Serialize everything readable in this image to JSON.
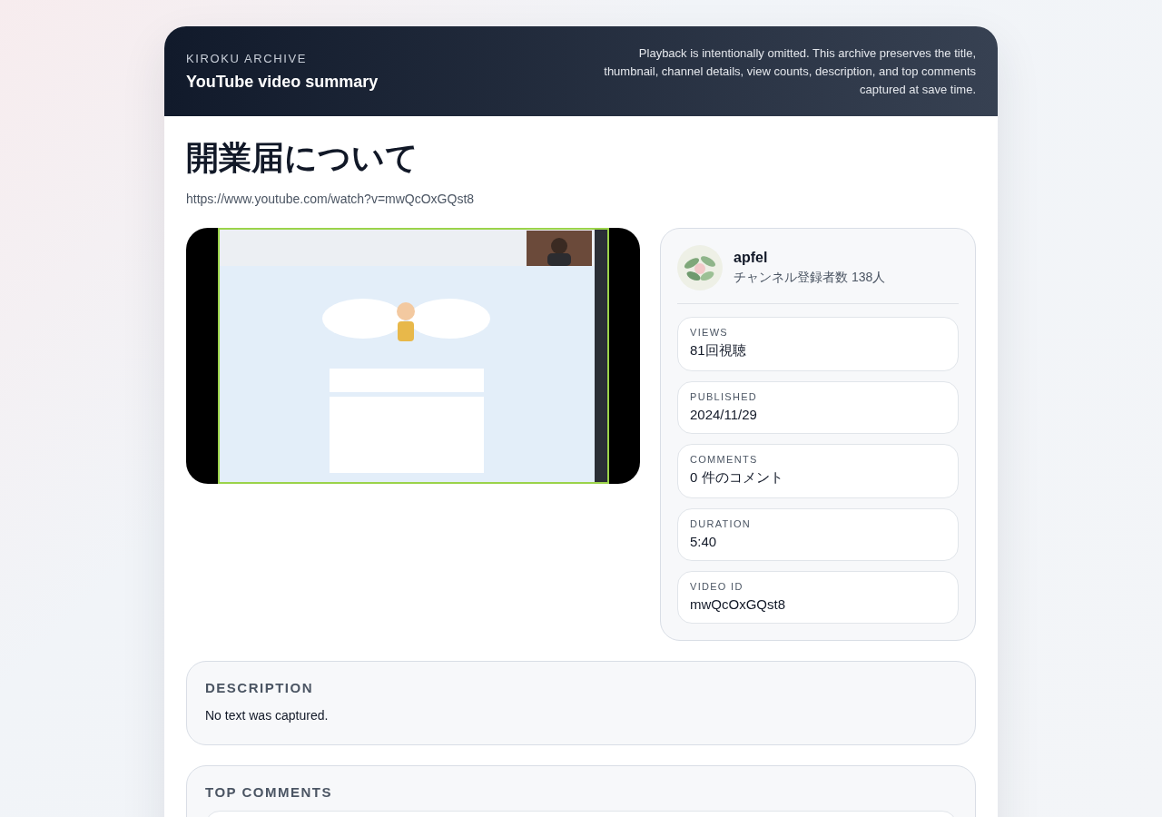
{
  "header": {
    "eyebrow": "KIROKU ARCHIVE",
    "title": "YouTube video summary",
    "note": "Playback is intentionally omitted. This archive preserves the title, thumbnail, channel details, view counts, description, and top comments captured at save time."
  },
  "video": {
    "title": "開業届について",
    "url": "https://www.youtube.com/watch?v=mwQcOxGQst8"
  },
  "channel": {
    "name": "apfel",
    "subscribers": "チャンネル登録者数 138人"
  },
  "stats": [
    {
      "label": "VIEWS",
      "value": "81回視聴"
    },
    {
      "label": "PUBLISHED",
      "value": "2024/11/29"
    },
    {
      "label": "COMMENTS",
      "value": "0 件のコメント"
    },
    {
      "label": "DURATION",
      "value": "5:40"
    },
    {
      "label": "VIDEO ID",
      "value": "mwQcOxGQst8"
    }
  ],
  "description": {
    "heading": "DESCRIPTION",
    "text": "No text was captured."
  },
  "top_comments": {
    "heading": "TOP COMMENTS"
  }
}
